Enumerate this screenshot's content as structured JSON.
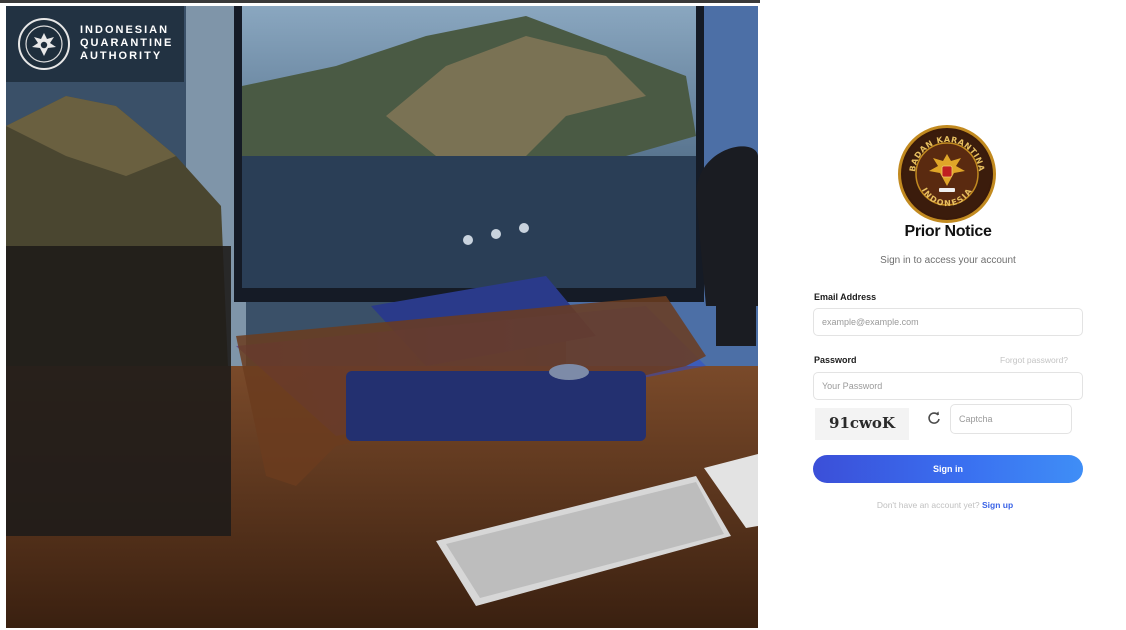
{
  "brand": {
    "line1": "INDONESIAN",
    "line2": "QUARANTINE",
    "line3": "AUTHORITY",
    "logo_icon": "garuda-emblem-icon"
  },
  "hero": {
    "image_description_icon": "desk-monitor-photo"
  },
  "login": {
    "emblem_icon": "badan-karantina-indonesia-emblem-icon",
    "emblem_text_top": "BADAN KARANTINA",
    "emblem_text_bottom": "INDONESIA",
    "title": "Prior Notice",
    "subtitle": "Sign in to access your account",
    "email_label": "Email Address",
    "email_placeholder": "example@example.com",
    "password_label": "Password",
    "forgot_label": "Forgot password?",
    "password_placeholder": "Your Password",
    "captcha_code": "91cwoK",
    "refresh_icon": "refresh-icon",
    "captcha_placeholder": "Captcha",
    "signin_label": "Sign in",
    "signup_prompt": "Don't have an account yet?",
    "signup_link": "Sign up"
  },
  "colors": {
    "primary": "#3a63e6",
    "emblem_ring": "#c28a20",
    "brand_overlay": "#14202c"
  }
}
